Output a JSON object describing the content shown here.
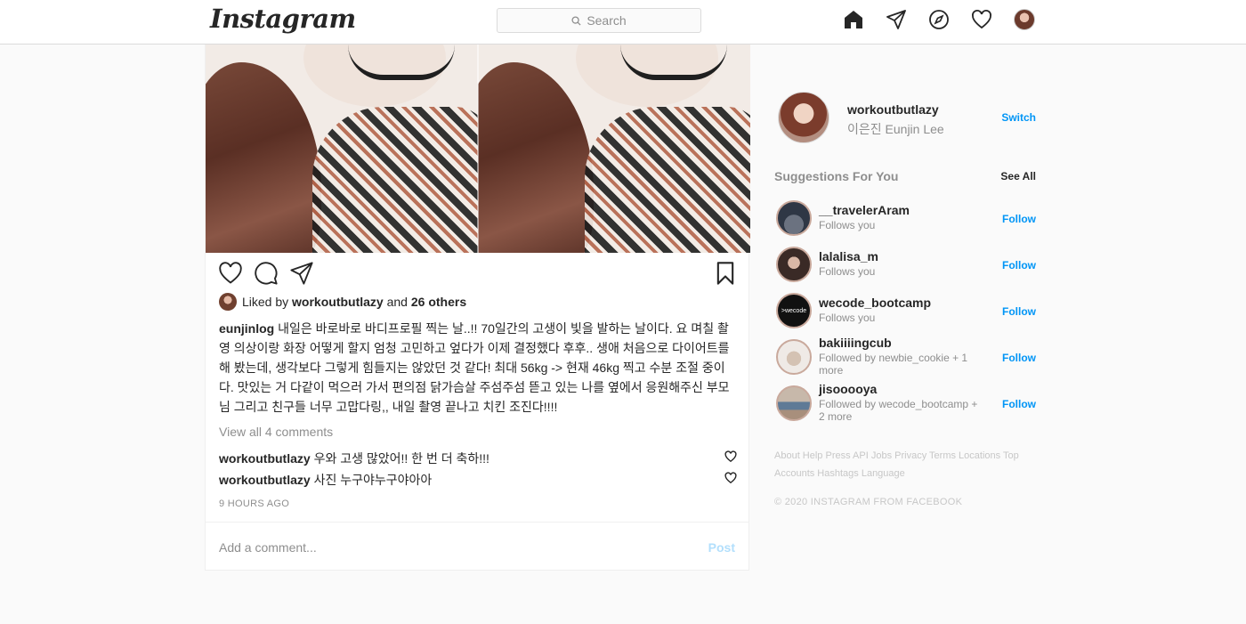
{
  "header": {
    "logo": "Instagram",
    "search_placeholder": "Search",
    "icons": [
      "home-icon",
      "direct-icon",
      "explore-icon",
      "activity-heart-icon",
      "profile-avatar"
    ]
  },
  "post": {
    "likes": {
      "prefix": "Liked by",
      "user": "workoutbutlazy",
      "and": "and",
      "others": "26 others"
    },
    "caption": {
      "user": "eunjinlog",
      "text": "내일은 바로바로 바디프로필 찍는 날..!! 70일간의 고생이 빛을 발하는 날이다. 요 며칠 촬영 의상이랑 화장 어떻게 할지 엄청 고민하고 엎다가 이제 결정했다 후후.. 생애 처음으로 다이어트를 해 봤는데, 생각보다 그렇게 힘들지는 않았던 것 같다! 최대 56kg -> 현재 46kg 찍고 수분 조절 중이다. 맛있는 거 다같이 먹으러 가서 편의점 닭가슴살 주섬주섬 뜯고 있는 나를 옆에서 응원해주신 부모님 그리고 친구들 너무 고맙다링,, 내일 촬영 끝나고 치킨 조진다!!!!"
    },
    "view_all": "View all 4 comments",
    "comments": [
      {
        "user": "workoutbutlazy",
        "text": "우와 고생 많았어!! 한 번 더 축하!!!"
      },
      {
        "user": "workoutbutlazy",
        "text": "사진 누구야누구야아아"
      }
    ],
    "time": "9 HOURS AGO",
    "add_comment_placeholder": "Add a comment...",
    "post_button": "Post"
  },
  "sidebar": {
    "me": {
      "username": "workoutbutlazy",
      "fullname": "이은진 Eunjin Lee",
      "switch": "Switch"
    },
    "suggestions_title": "Suggestions For You",
    "see_all": "See All",
    "suggestions": [
      {
        "username": "__travelerAram",
        "sub": "Follows you",
        "follow": "Follow",
        "avatar_color": "#4a5563"
      },
      {
        "username": "lalalisa_m",
        "sub": "Follows you",
        "follow": "Follow",
        "avatar_color": "#3a2a26"
      },
      {
        "username": "wecode_bootcamp",
        "sub": "Follows you",
        "follow": "Follow",
        "avatar_color": "#111111",
        "avatar_text": ">wecode"
      },
      {
        "username": "bakiiiingcub",
        "sub": "Followed by newbie_cookie + 1 more",
        "follow": "Follow",
        "avatar_color": "#e9e4e0"
      },
      {
        "username": "jisooooya",
        "sub": "Followed by wecode_bootcamp + 2 more",
        "follow": "Follow",
        "avatar_color": "#b7a89c"
      }
    ],
    "footer_links": "About Help Press API Jobs Privacy Terms Locations Top Accounts Hashtags Language",
    "copyright": "© 2020 INSTAGRAM FROM FACEBOOK"
  }
}
